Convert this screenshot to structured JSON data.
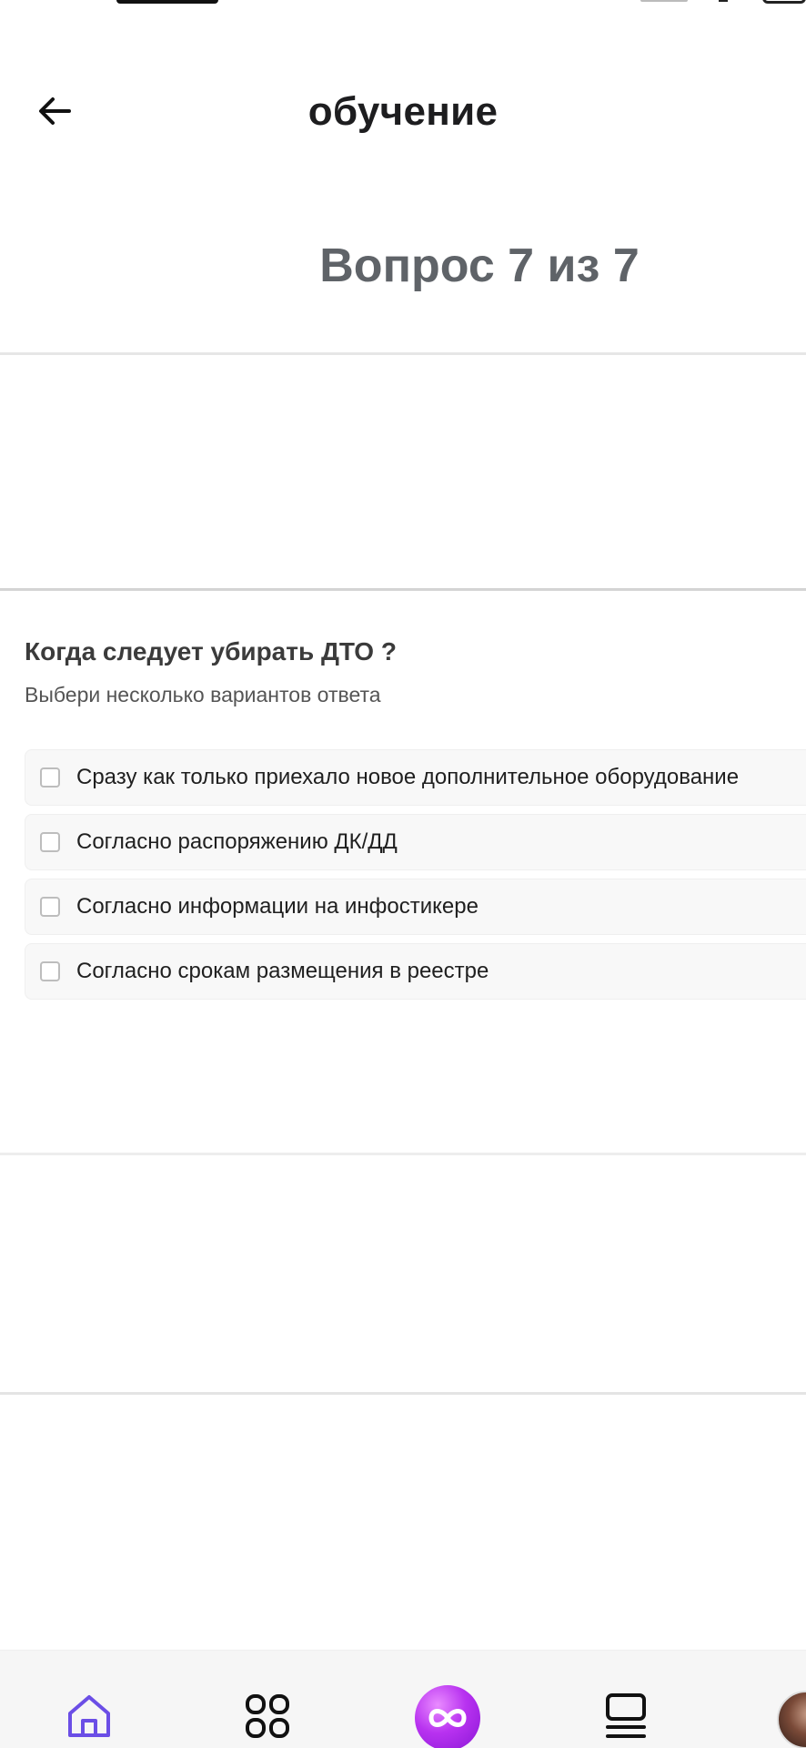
{
  "header": {
    "title": "обучение",
    "back_icon": "arrow-left-icon"
  },
  "quiz": {
    "counter": "Вопрос 7 из 7",
    "question": "Когда следует убирать ДТО ?",
    "hint": "Выбери несколько вариантов ответа",
    "options": [
      {
        "label": "Сразу как только приехало новое дополнительное оборудование",
        "checked": false
      },
      {
        "label": "Согласно распоряжению ДК/ДД",
        "checked": false
      },
      {
        "label": "Согласно информации на инфостикере",
        "checked": false
      },
      {
        "label": "Согласно срокам размещения в реестре",
        "checked": false
      }
    ]
  },
  "tabbar": {
    "items": [
      {
        "icon": "home-icon",
        "active": true
      },
      {
        "icon": "grid-icon",
        "active": false
      },
      {
        "icon": "infinity-icon",
        "active": false
      },
      {
        "icon": "feed-icon",
        "active": false
      },
      {
        "icon": "avatar",
        "active": false
      }
    ]
  },
  "colors": {
    "accent": "#6b4ee6",
    "center_button": "#b832f0",
    "counter_text": "#5f6368"
  }
}
